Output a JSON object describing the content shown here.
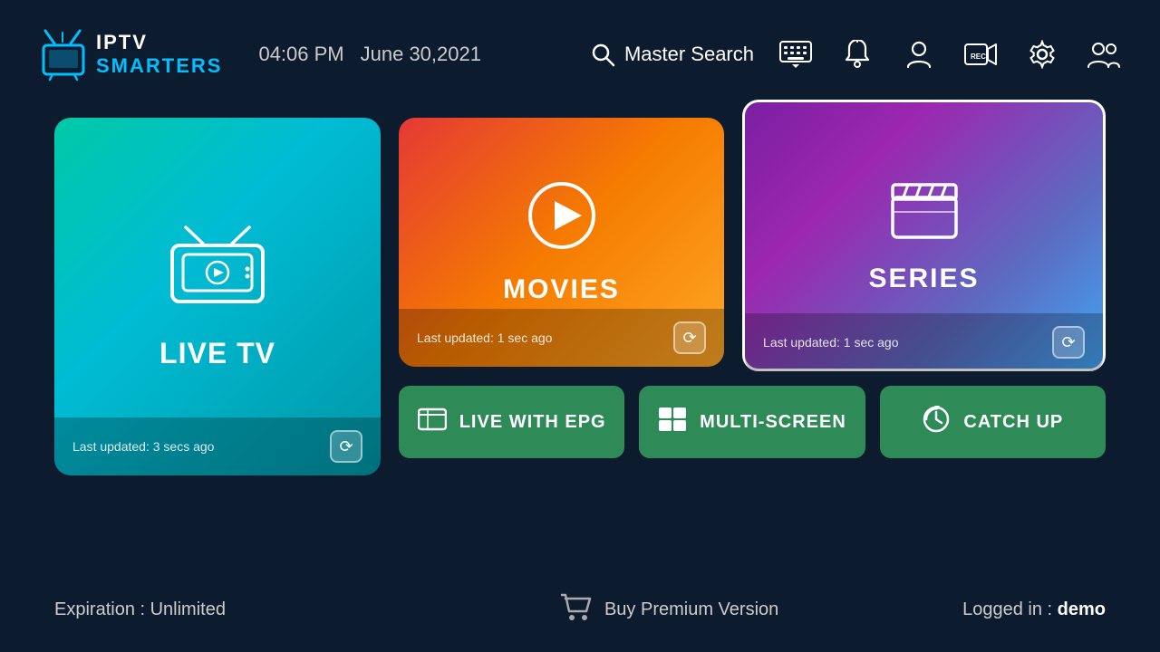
{
  "header": {
    "logo_iptv": "IPTV",
    "logo_smarters": "SMARTERS",
    "time": "04:06 PM",
    "date": "June 30,2021",
    "search_label": "Master Search"
  },
  "cards": {
    "live_tv": {
      "label": "LIVE TV",
      "last_updated": "Last updated: 3 secs ago"
    },
    "movies": {
      "label": "MOVIES",
      "last_updated": "Last updated: 1 sec ago"
    },
    "series": {
      "label": "SERIES",
      "last_updated": "Last updated: 1 sec ago"
    }
  },
  "buttons": {
    "live_epg": "LIVE WITH EPG",
    "multi_screen": "MULTI-SCREEN",
    "catch_up": "CATCH UP"
  },
  "footer": {
    "expiration": "Expiration : Unlimited",
    "buy_premium": "Buy Premium Version",
    "logged_in_label": "Logged in : ",
    "logged_in_user": "demo"
  }
}
